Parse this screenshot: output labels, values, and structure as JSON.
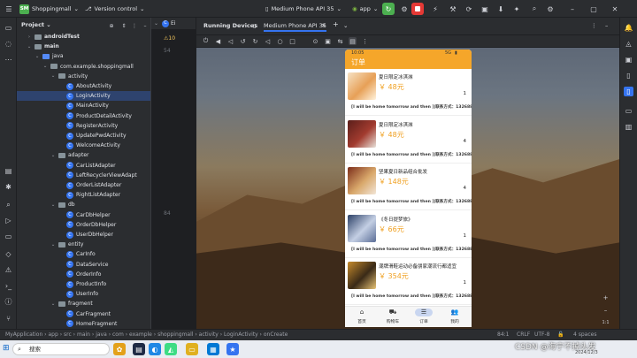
{
  "titlebar": {
    "project_badge": "SM",
    "project_name": "Shoppingmall",
    "vcs": "Version control",
    "device": "Medium Phone API 35",
    "run_config": "app",
    "colors": {
      "run": "#4caf50",
      "stop": "#e53935",
      "project_badge": "#4caf50"
    }
  },
  "project_panel": {
    "title": "Project",
    "tree": [
      {
        "label": "androidTest",
        "kind": "folder",
        "depth": 2,
        "bold": true
      },
      {
        "label": "main",
        "kind": "folder",
        "depth": 2,
        "bold": true
      },
      {
        "label": "java",
        "kind": "folder-blue",
        "depth": 3
      },
      {
        "label": "com.example.shoppingmall",
        "kind": "folder",
        "depth": 4
      },
      {
        "label": "activity",
        "kind": "folder",
        "depth": 5
      },
      {
        "label": "AboutActivity",
        "kind": "class",
        "depth": 6
      },
      {
        "label": "LoginActivity",
        "kind": "class",
        "depth": 6,
        "selected": true
      },
      {
        "label": "MainActivity",
        "kind": "class",
        "depth": 6
      },
      {
        "label": "ProductDetailActivity",
        "kind": "class",
        "depth": 6
      },
      {
        "label": "RegisterActivity",
        "kind": "class",
        "depth": 6
      },
      {
        "label": "UpdatePwdActivity",
        "kind": "class",
        "depth": 6
      },
      {
        "label": "WelcomeActivity",
        "kind": "class",
        "depth": 6
      },
      {
        "label": "adapter",
        "kind": "folder",
        "depth": 5
      },
      {
        "label": "CarListAdapter",
        "kind": "class",
        "depth": 6
      },
      {
        "label": "LeftRecyclerViewAdapt",
        "kind": "class",
        "depth": 6
      },
      {
        "label": "OrderListAdapter",
        "kind": "class",
        "depth": 6
      },
      {
        "label": "RightListAdapter",
        "kind": "class",
        "depth": 6
      },
      {
        "label": "db",
        "kind": "folder",
        "depth": 5
      },
      {
        "label": "CarDbHelper",
        "kind": "class",
        "depth": 6
      },
      {
        "label": "OrderDbHelper",
        "kind": "class",
        "depth": 6
      },
      {
        "label": "UserDbHelper",
        "kind": "class",
        "depth": 6
      },
      {
        "label": "entity",
        "kind": "folder",
        "depth": 5
      },
      {
        "label": "CarInfo",
        "kind": "class",
        "depth": 6
      },
      {
        "label": "DataService",
        "kind": "class",
        "depth": 6
      },
      {
        "label": "OrderInfo",
        "kind": "class",
        "depth": 6
      },
      {
        "label": "ProductInfo",
        "kind": "class",
        "depth": 6
      },
      {
        "label": "UserInfo",
        "kind": "class",
        "depth": 6
      },
      {
        "label": "fragment",
        "kind": "folder",
        "depth": 5
      },
      {
        "label": "CarFragment",
        "kind": "class",
        "depth": 6
      },
      {
        "label": "HomeFragment",
        "kind": "class",
        "depth": 6
      }
    ]
  },
  "editor": {
    "tab_label": "Ei",
    "warning_count": "10",
    "line_numbers": [
      "54",
      "84"
    ]
  },
  "running_devices": {
    "title": "Running Devices",
    "device_tab": "Medium Phone API 35",
    "add_tab": "+"
  },
  "phone": {
    "time": "10:05",
    "signal": "5G",
    "screen_title": "订单",
    "orders": [
      {
        "title": "夏日限定冰淇淋",
        "price": "￥ 48元",
        "qty": "1",
        "note": "[I will be home tomorrow and then ]|联系方式：13268825225",
        "thumb_colors": [
          "#f6e2c4",
          "#e7a057",
          "#fff3dd"
        ]
      },
      {
        "title": "夏日限定冰淇淋",
        "price": "￥ 48元",
        "qty": "4",
        "note": "[I will be home tomorrow and then ]|联系方式：13268825225",
        "thumb_colors": [
          "#5a1e1a",
          "#a23b2f",
          "#e8e2da"
        ]
      },
      {
        "title": "坚果夏日新品组合批发",
        "price": "￥ 148元",
        "qty": "4",
        "note": "[I will be home tomorrow and then ]|联系方式：13268825225",
        "thumb_colors": [
          "#7c2d1a",
          "#d9a86b",
          "#f2e6d8"
        ]
      },
      {
        "title": "《冬日提梦旅》",
        "price": "￥ 66元",
        "qty": "1",
        "note": "[I will be home tomorrow and then ]|联系方式：13268825225",
        "thumb_colors": [
          "#2b3f66",
          "#c4cfe4",
          "#5a6d96"
        ]
      },
      {
        "title": "潮牌滑鞋运动必备朋家潮流行都适宜",
        "price": "￥ 354元",
        "qty": "1",
        "note": "[I will be home tomorrow and then ]|联系方式：13268825225",
        "thumb_colors": [
          "#c68b2c",
          "#3a2a17",
          "#e8c476"
        ]
      }
    ],
    "nav": [
      {
        "label": "首页",
        "icon": "home-icon",
        "glyph": "⌂"
      },
      {
        "label": "购物车",
        "icon": "cart-icon",
        "glyph": "⛟"
      },
      {
        "label": "订单",
        "icon": "order-icon",
        "glyph": "☰",
        "active": true
      },
      {
        "label": "我的",
        "icon": "person-icon",
        "glyph": "👥"
      }
    ],
    "colors": {
      "primary": "#f5a62a",
      "price": "#f0a020",
      "nav_active": "#c9d6f0"
    }
  },
  "statusbar": {
    "breadcrumb": [
      "MyApplication",
      "app",
      "src",
      "main",
      "java",
      "com",
      "example",
      "shoppingmall",
      "activity",
      "LoginActivity",
      "onCreate"
    ],
    "position": "84:1",
    "line_sep": "CRLF",
    "encoding": "UTF-8",
    "indent": "4 spaces"
  },
  "taskbar": {
    "search_placeholder": "搜索",
    "watermark": "CSDN @海宁不掉头发",
    "date": "2024/12/3"
  }
}
